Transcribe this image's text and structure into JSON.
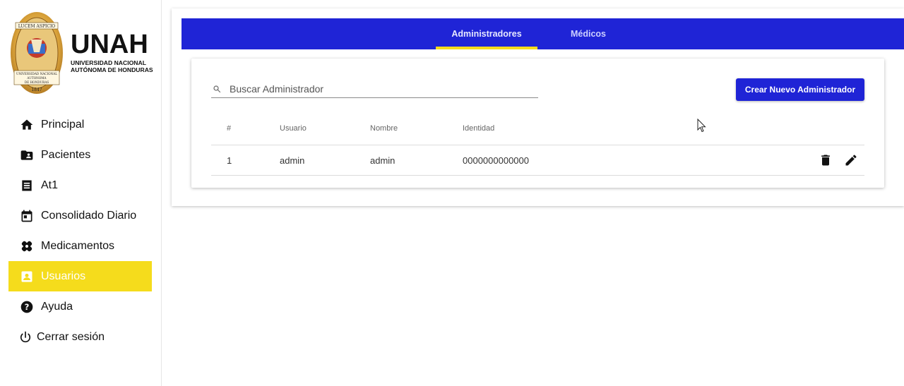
{
  "brand": {
    "name": "UNAH",
    "subtitle_line1": "UNIVERSIDAD NACIONAL",
    "subtitle_line2": "AUTÓNOMA DE HONDURAS",
    "seal_motto": "LUCEM ASPICIO",
    "seal_banner_line1": "UNIVERSIDAD NACIONAL",
    "seal_banner_line2": "AUTONOMA",
    "seal_banner_line3": "DE HONDURAS",
    "seal_year": "1847"
  },
  "sidebar": {
    "items": [
      {
        "label": "Principal",
        "icon": "home-icon"
      },
      {
        "label": "Pacientes",
        "icon": "folder-person-icon"
      },
      {
        "label": "At1",
        "icon": "receipt-icon"
      },
      {
        "label": "Consolidado Diario",
        "icon": "calendar-icon"
      },
      {
        "label": "Medicamentos",
        "icon": "bandage-icon"
      },
      {
        "label": "Usuarios",
        "icon": "account-box-icon",
        "active": true
      },
      {
        "label": "Ayuda",
        "icon": "help-icon"
      },
      {
        "label": "Cerrar sesión",
        "icon": "power-icon"
      }
    ]
  },
  "tabs": [
    {
      "label": "Administradores",
      "active": true
    },
    {
      "label": "Médicos",
      "active": false
    }
  ],
  "search": {
    "placeholder": "Buscar Administrador",
    "value": ""
  },
  "create_button": "Crear Nuevo Administrador",
  "table": {
    "headers": [
      "#",
      "Usuario",
      "Nombre",
      "Identidad"
    ],
    "rows": [
      {
        "num": "1",
        "usuario": "admin",
        "nombre": "admin",
        "identidad": "0000000000000"
      }
    ]
  },
  "colors": {
    "primary": "#1f24d6",
    "accent": "#f5dc1c"
  }
}
